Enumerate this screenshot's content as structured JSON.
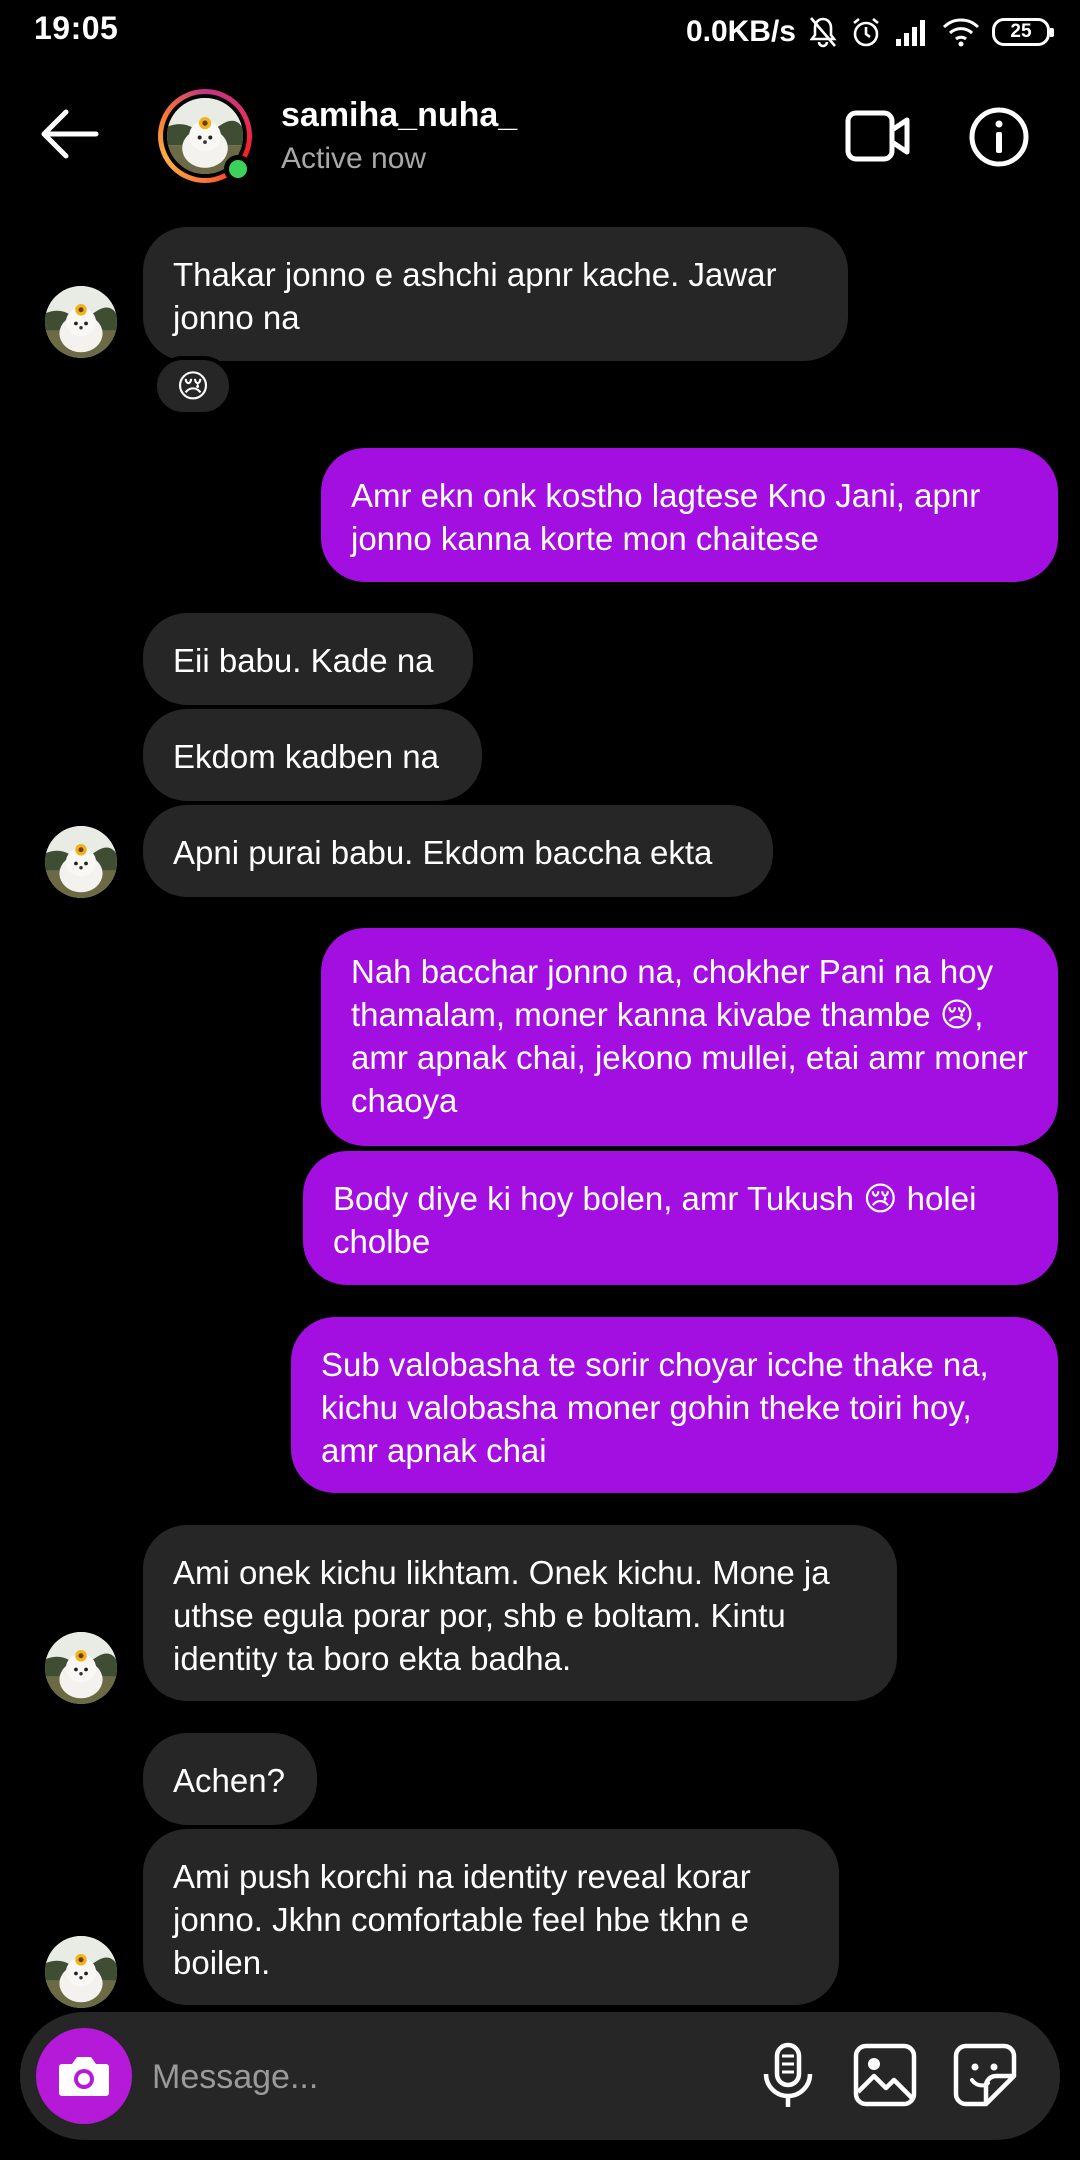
{
  "status_bar": {
    "time": "19:05",
    "network_speed": "0.0KB/s",
    "battery_level": "25",
    "icons": [
      "bell-muted-icon",
      "alarm-icon",
      "signal-icon",
      "wifi-icon",
      "battery-icon"
    ]
  },
  "header": {
    "username": "samiha_nuha_",
    "status": "Active now",
    "icons": [
      "back-arrow-icon",
      "video-call-icon",
      "info-icon"
    ],
    "online_indicator_color": "#3cd25a"
  },
  "messages": [
    {
      "from": "them",
      "text": "Thakar jonno e ashchi apnr kache. Jawar jonno na",
      "reaction": "😢"
    },
    {
      "from": "me",
      "text": "Amr ekn onk kostho lagtese Kno Jani, apnr jonno kanna korte mon chaitese"
    },
    {
      "from": "them",
      "text": "Eii babu. Kade na"
    },
    {
      "from": "them",
      "text": "Ekdom kadben na"
    },
    {
      "from": "them",
      "text": "Apni purai babu. Ekdom baccha ekta"
    },
    {
      "from": "me",
      "text": "Nah bacchar jonno na, chokher Pani na hoy thamalam, moner kanna kivabe thambe 😢, amr apnak chai, jekono mullei, etai amr moner chaoya"
    },
    {
      "from": "me",
      "text": "Body diye ki hoy bolen, amr Tukush 😢 holei cholbe"
    },
    {
      "from": "me",
      "text": "Sub valobasha te sorir choyar icche thake na, kichu valobasha moner gohin theke toiri hoy, amr apnak chai"
    },
    {
      "from": "them",
      "text": "Ami onek kichu likhtam. Onek kichu. Mone ja uthse egula porar por, shb e boltam. Kintu identity ta boro ekta badha."
    },
    {
      "from": "them",
      "text": "Achen?"
    },
    {
      "from": "them",
      "text": "Ami push korchi na identity reveal korar jonno. Jkhn comfortable feel hbe tkhn e boilen."
    }
  ],
  "composer": {
    "placeholder": "Message...",
    "icons": [
      "camera-icon",
      "microphone-icon",
      "gallery-icon",
      "sticker-icon"
    ]
  },
  "colors": {
    "sent_bubble": "#a30fe0",
    "received_bubble": "#262626",
    "camera_button": "#b51ad8",
    "background": "#000000"
  }
}
